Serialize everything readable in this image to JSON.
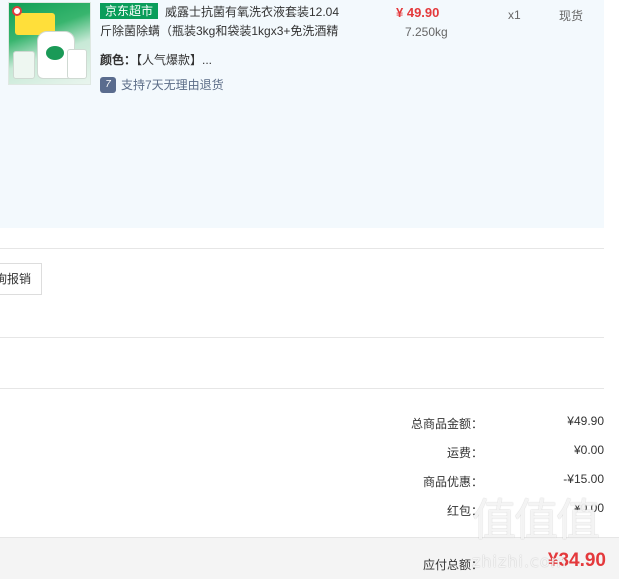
{
  "item": {
    "tag": "京东超市",
    "title": "威露士抗菌有氧洗衣液套装12.04斤除菌除螨（瓶装3kg和袋装1kgx3+免洗酒精",
    "spec_label": "颜色：",
    "spec_value": "【人气爆款】...",
    "service_icon": "7",
    "service_text": "支持7天无理由退货",
    "price": "¥ 49.90",
    "weight": "7.250kg",
    "quantity": "x1",
    "stock": "现货"
  },
  "invoice": {
    "button_label": "询报销"
  },
  "summary": {
    "rows": [
      {
        "label": "总商品金额：",
        "value": "¥49.90"
      },
      {
        "label": "运费：",
        "value": "¥0.00"
      },
      {
        "label": "商品优惠：",
        "value": "-¥15.00"
      },
      {
        "label": "红包：",
        "value": "¥0.00"
      }
    ],
    "total_label": "应付总额：",
    "total_value": "¥34.90"
  },
  "watermark": {
    "glyphs": "值值值",
    "text": "zhizhi.com"
  },
  "colors": {
    "accent_red": "#e4393c",
    "jd_green": "#0a9d5a",
    "panel_bg": "#f3f9fd"
  }
}
